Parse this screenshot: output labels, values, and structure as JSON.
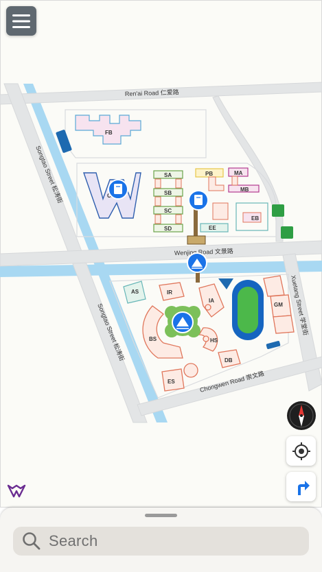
{
  "map": {
    "roads": {
      "renai": "Ren'ai Road 仁爱路",
      "wenjing": "Wenjing Road 文景路",
      "songtao_north": "Songtao Street 松涛街",
      "songtao_south": "Songtao Street 松涛街",
      "xuetang": "Xuetang Street 学堂街",
      "chongwen": "Chongwen Road 崇文路"
    },
    "buildings": {
      "fb": "FB",
      "cb": "CB",
      "sa": "SA",
      "sb": "SB",
      "sc": "SC",
      "sd": "SD",
      "pb": "PB",
      "ma": "MA",
      "mb": "MB",
      "eb": "EB",
      "ee": "EE",
      "as": "AS",
      "ir": "IR",
      "ia": "IA",
      "bs": "BS",
      "hs": "HS",
      "db": "DB",
      "es": "ES",
      "gm": "GM"
    },
    "icons": {
      "library_1": "book-icon",
      "library_2": "book-icon",
      "landmark_1": "landmark-icon",
      "landmark_2": "landmark-icon"
    }
  },
  "controls": {
    "menu": "menu-icon",
    "compass": "compass-icon",
    "locate": "locate-icon",
    "navigate": "navigation-icon"
  },
  "search": {
    "placeholder": "Search"
  },
  "colors": {
    "water": "#a8d8f2",
    "road": "#e3e5e6",
    "marker": "#1a73e8",
    "sheet": "#f6f5f2",
    "search_box": "#e4e1dc",
    "grass": "#2e9e44",
    "track": "#1565c0"
  }
}
